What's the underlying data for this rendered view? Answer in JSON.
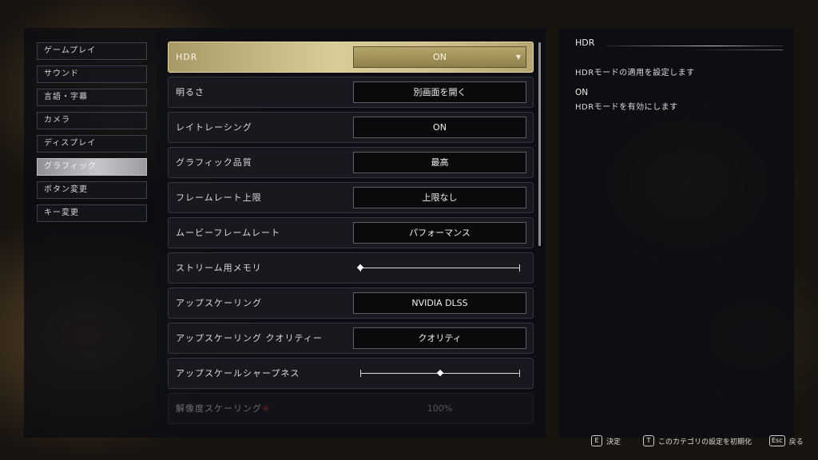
{
  "sidebar": {
    "items": [
      {
        "label": "ゲームプレイ",
        "active": false
      },
      {
        "label": "サウンド",
        "active": false
      },
      {
        "label": "言語・字幕",
        "active": false
      },
      {
        "label": "カメラ",
        "active": false
      },
      {
        "label": "ディスプレイ",
        "active": false
      },
      {
        "label": "グラフィック",
        "active": true
      },
      {
        "label": "ボタン変更",
        "active": false
      },
      {
        "label": "キー変更",
        "active": false
      }
    ]
  },
  "settings": [
    {
      "label": "HDR",
      "type": "dropdown",
      "value": "ON",
      "active": true
    },
    {
      "label": "明るさ",
      "type": "button",
      "value": "別画面を開く"
    },
    {
      "label": "レイトレーシング",
      "type": "select",
      "value": "ON"
    },
    {
      "label": "グラフィック品質",
      "type": "select",
      "value": "最高"
    },
    {
      "label": "フレームレート上限",
      "type": "select",
      "value": "上限なし"
    },
    {
      "label": "ムービーフレームレート",
      "type": "select",
      "value": "パフォーマンス"
    },
    {
      "label": "ストリーム用メモリ",
      "type": "slider",
      "level": 0.0
    },
    {
      "label": "アップスケーリング",
      "type": "select",
      "value": "NVIDIA DLSS"
    },
    {
      "label": "アップスケーリング クオリティー",
      "type": "select",
      "value": "クオリティ"
    },
    {
      "label": "アップスケールシャープネス",
      "type": "slider",
      "level": 0.5
    },
    {
      "label": "解像度スケーリング",
      "mark": "※",
      "type": "disabled",
      "value": "100%"
    }
  ],
  "detail": {
    "title": "HDR",
    "description": "HDRモードの適用を設定します",
    "option": "ON",
    "option_description": "HDRモードを有効にします"
  },
  "hints": [
    {
      "key": "E",
      "label": "決定"
    },
    {
      "key": "T",
      "label": "このカテゴリの設定を初期化"
    },
    {
      "key": "Esc",
      "label": "戻る"
    }
  ],
  "colors": {
    "active_row": "#d8cc99",
    "active_category": "#c5c7cb",
    "warning_mark": "#d23a3a"
  }
}
